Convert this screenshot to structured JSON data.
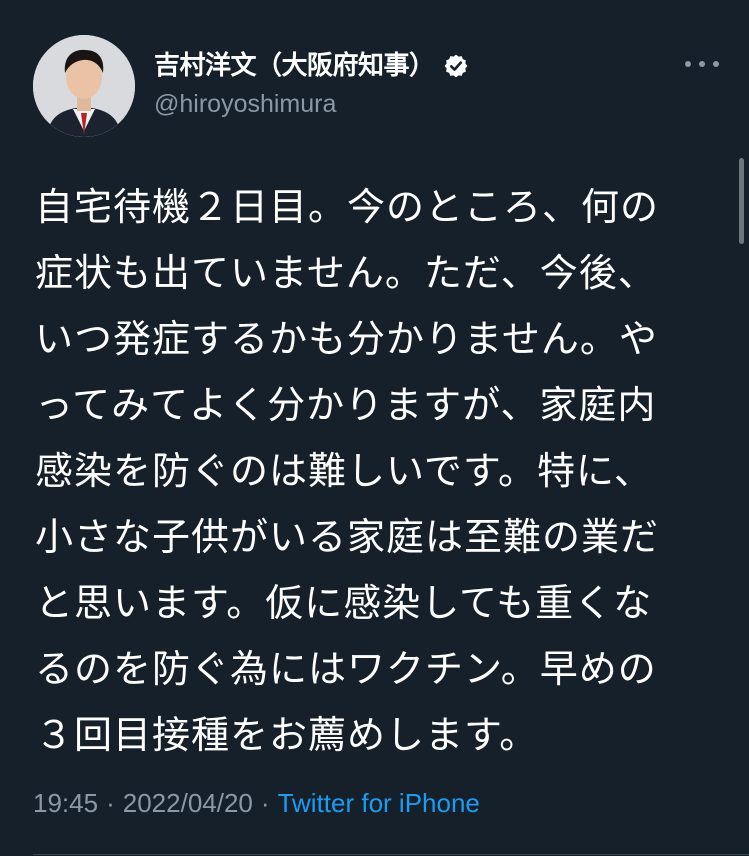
{
  "author": {
    "display_name": "吉村洋文（大阪府知事）",
    "handle": "@hiroyoshimura",
    "verified": true
  },
  "tweet": {
    "lines": [
      "自宅待機２日目。今のところ、何の",
      "症状も出ていません。ただ、今後、",
      "いつ発症するかも分かりません。や",
      "ってみてよく分かりますが、家庭内",
      "感染を防ぐのは難しいです。特に、",
      "小さな子供がいる家庭は至難の業だ",
      "と思います。仮に感染しても重くな",
      "るのを防ぐ為にはワクチン。早めの",
      "３回目接種をお薦めします。"
    ],
    "time": "19:45",
    "separator": "·",
    "date": "2022/04/20",
    "source": "Twitter for iPhone"
  },
  "icons": {
    "verified": "verified-badge-icon",
    "more": "more-options-icon"
  },
  "colors": {
    "background": "#15202b",
    "text": "#ffffff",
    "muted": "#8b98a5",
    "accent": "#1d9bf0",
    "divider": "#38444d"
  }
}
